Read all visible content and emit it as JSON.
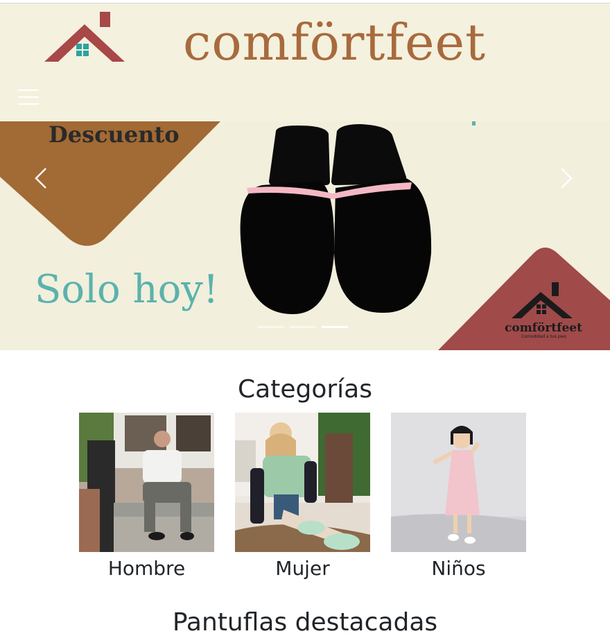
{
  "brand": {
    "name": "comförtfeet",
    "tagline": "Comodidad a tus pies"
  },
  "colors": {
    "header_bg": "#f4f1df",
    "brand_brown": "#a86a3d",
    "house_red": "#a84848",
    "teal": "#5bb2ac"
  },
  "carousel": {
    "discount_label": "Descuento",
    "promo_text": "Solo hoy!",
    "indicators": 3,
    "active_slide": 3
  },
  "categories": {
    "title": "Categorías",
    "items": [
      {
        "label": "Hombre"
      },
      {
        "label": "Mujer"
      },
      {
        "label": "Niños"
      }
    ]
  },
  "featured": {
    "title": "Pantuflas destacadas"
  }
}
